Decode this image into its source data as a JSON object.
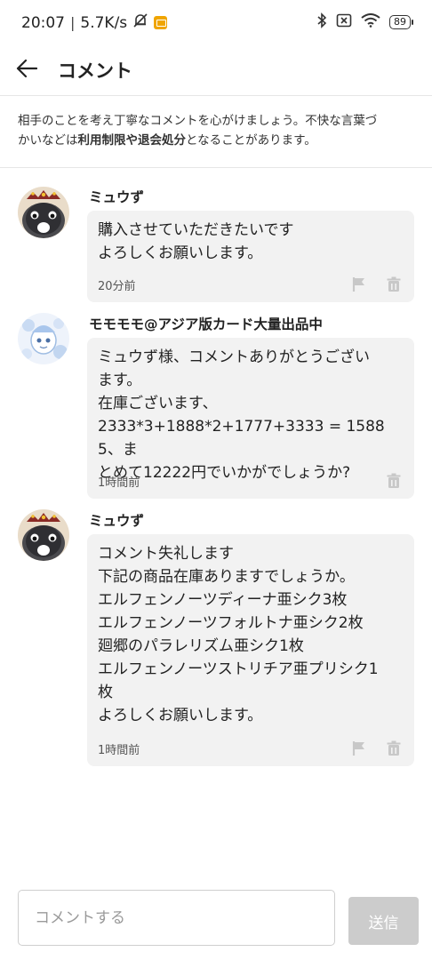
{
  "status_bar": {
    "time": "20:07",
    "separator": "|",
    "network_speed": "5.7K/s",
    "battery_level": "89",
    "icons": [
      "mute-bell-icon",
      "notification-icon",
      "bluetooth-icon",
      "sim-off-icon",
      "wifi-icon",
      "battery-icon"
    ]
  },
  "header": {
    "back_icon": "arrow-left-icon",
    "title": "コメント"
  },
  "notice": {
    "line1": "相手のことを考え丁寧なコメントを心がけましょう。不快な言葉づ",
    "line2_prefix": "かいなどは",
    "line2_bold": "利用制限や退会処分",
    "line2_suffix": "となることがあります。"
  },
  "comments": [
    {
      "user": "ミュウず",
      "text": "購入させていただきたいです\nよろしくお願いします。",
      "time": "20分前",
      "actions": [
        "flag-icon",
        "trash-icon"
      ]
    },
    {
      "user": "モモモモ@アジア版カード大量出品中",
      "text": "ミュウず様、コメントありがとうござい\nます。\n在庫ございます、\n2333*3+1888*2+1777+3333 = 15885、ま\nとめて12222円でいかがでしょうか?",
      "time": "1時間前",
      "actions": [
        "trash-icon"
      ]
    },
    {
      "user": "ミュウず",
      "text": "コメント失礼します\n下記の商品在庫ありますでしょうか。\nエルフェンノーツディーナ亜シク3枚\nエルフェンノーツフォルトナ亜シク2枚\n廻郷のパラレリズム亜シク1枚\nエルフェンノーツストリチア亜プリシク1\n枚\nよろしくお願いします。",
      "time": "1時間前",
      "actions": [
        "flag-icon",
        "trash-icon"
      ]
    }
  ],
  "composer": {
    "value": "",
    "placeholder": "コメントする",
    "send_label": "送信"
  },
  "colors": {
    "bubble_bg": "#f2f2f2",
    "send_button_disabled": "#cccccc",
    "action_icon": "#c8c8c8",
    "divider": "#e6e6e6"
  }
}
